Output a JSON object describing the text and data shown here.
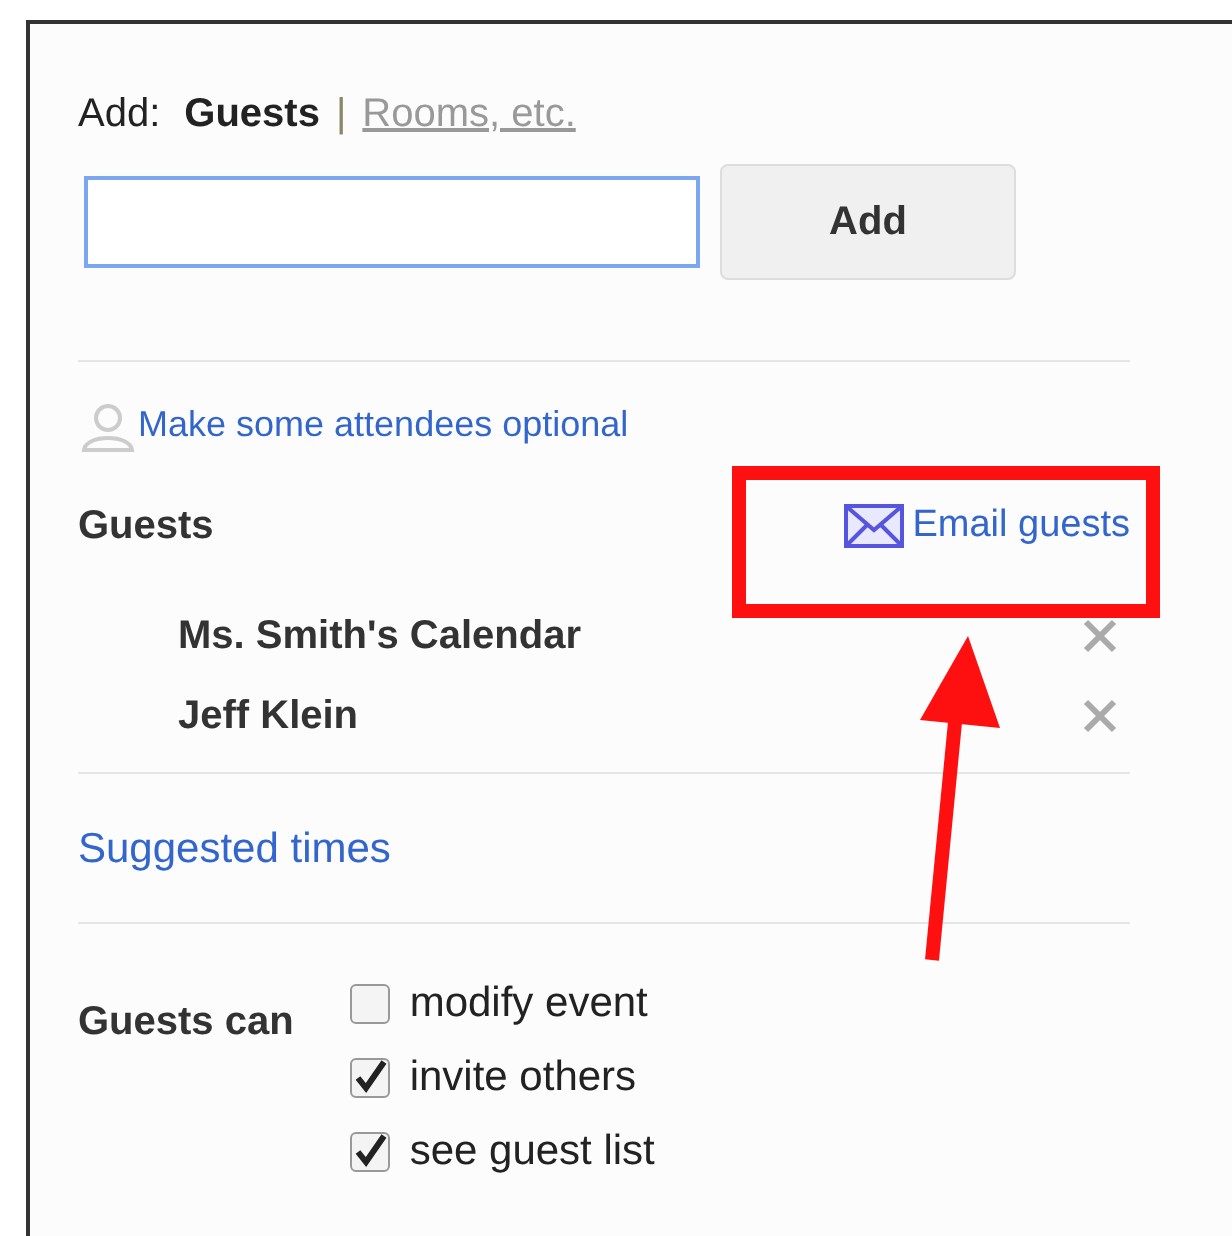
{
  "add_bar": {
    "label": "Add:",
    "tabs": [
      {
        "label": "Guests",
        "selected": true
      },
      {
        "label": "Rooms, etc.",
        "selected": false
      }
    ],
    "separator": "|",
    "button": "Add"
  },
  "optional_link": "Make some attendees optional",
  "guests": {
    "title": "Guests",
    "email_link": "Email guests",
    "highlighted": true,
    "list": [
      {
        "name": "Ms. Smith's Calendar"
      },
      {
        "name": "Jeff Klein"
      }
    ]
  },
  "suggested_times": "Suggested times",
  "permissions": {
    "label": "Guests can",
    "options": [
      {
        "label": "modify event",
        "checked": false
      },
      {
        "label": "invite others",
        "checked": true
      },
      {
        "label": "see guest list",
        "checked": true
      }
    ]
  }
}
